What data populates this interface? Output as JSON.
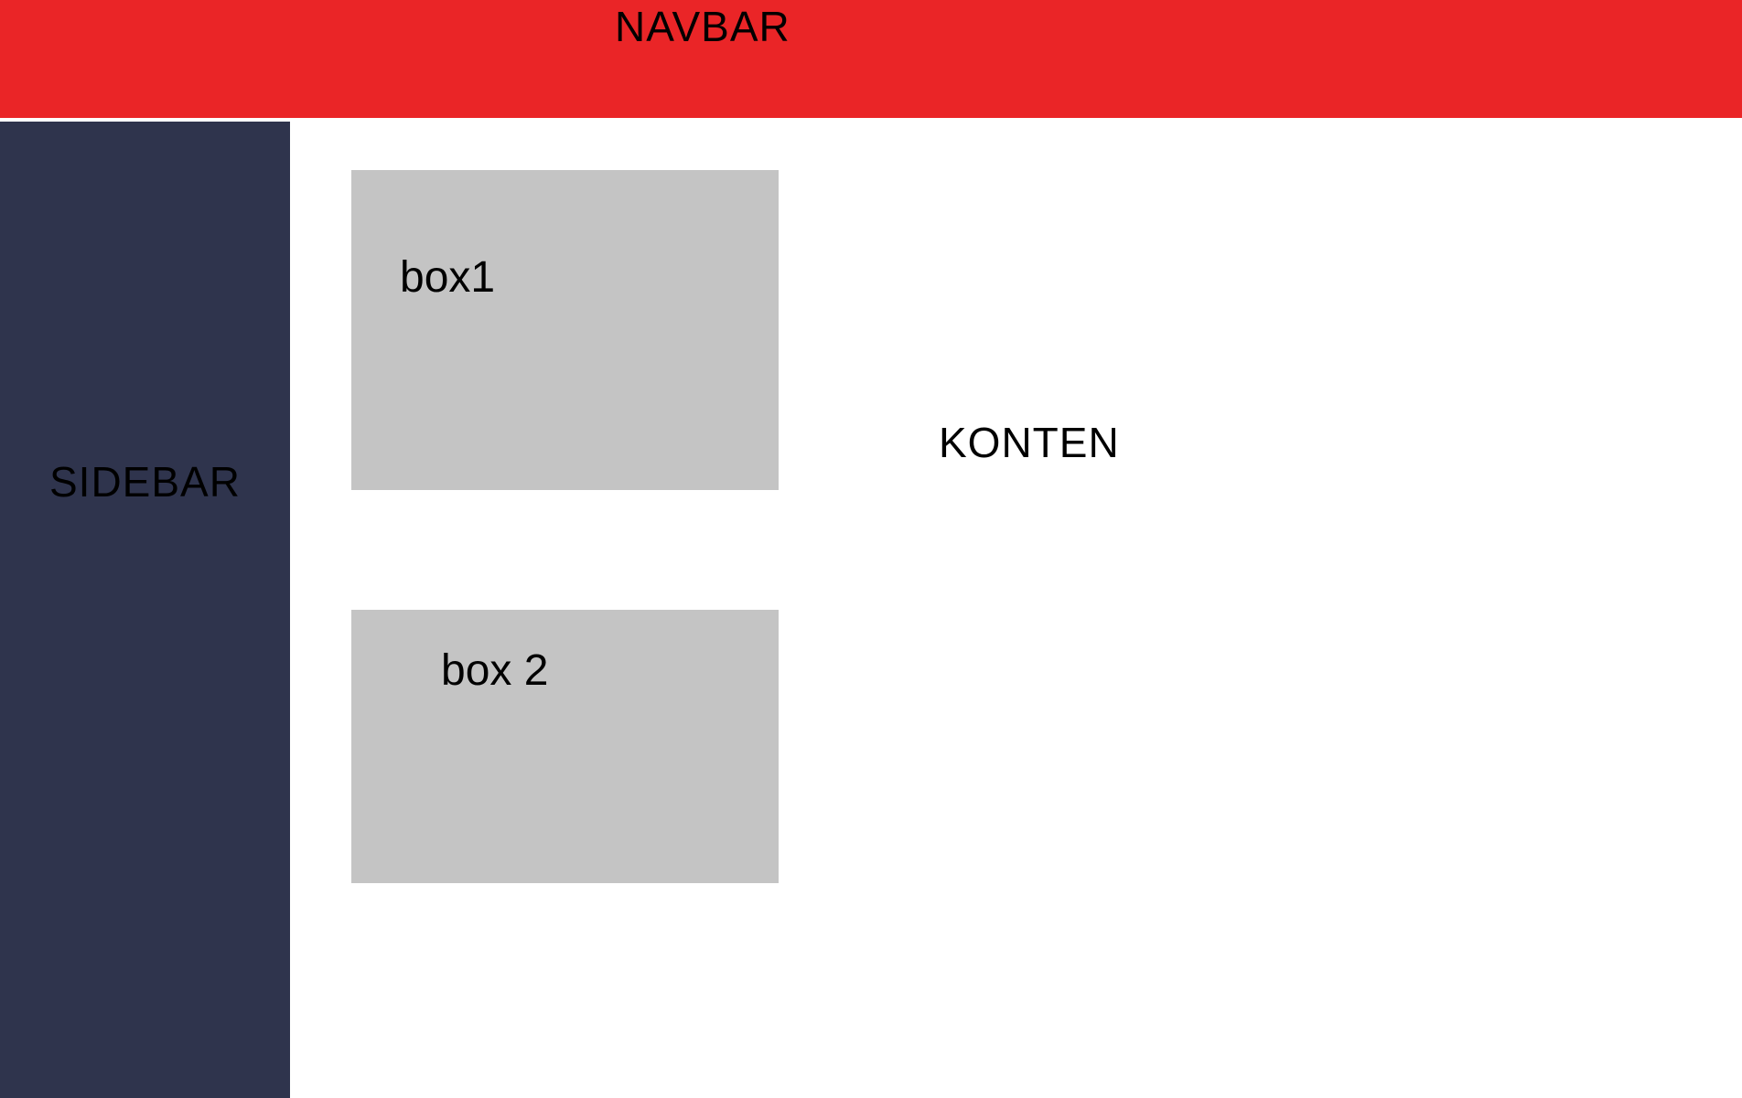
{
  "navbar": {
    "title": "NAVBAR"
  },
  "sidebar": {
    "title": "SIDEBAR"
  },
  "content": {
    "title": "KONTEN",
    "boxes": [
      {
        "label": "box1"
      },
      {
        "label": "box 2"
      }
    ]
  },
  "colors": {
    "navbar": "#ea2527",
    "sidebar": "#2f344d",
    "box": "#c4c4c4",
    "content_background": "#ffffff",
    "text": "#000000"
  }
}
